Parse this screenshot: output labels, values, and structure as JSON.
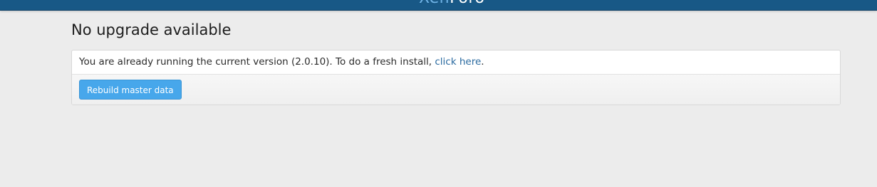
{
  "header": {
    "logo_part1": "Xen",
    "logo_part2": "Foro",
    "colors": {
      "bar": "#185886",
      "logo_accent": "#6fb3e6"
    }
  },
  "main": {
    "title": "No upgrade available",
    "message": {
      "prefix": "You are already running the current version (2.0.10). To do a fresh install, ",
      "link": "click here",
      "suffix": "."
    },
    "rebuild_button": "Rebuild master data",
    "colors": {
      "button": "#47a7eb",
      "link": "#2a6aa0"
    }
  }
}
